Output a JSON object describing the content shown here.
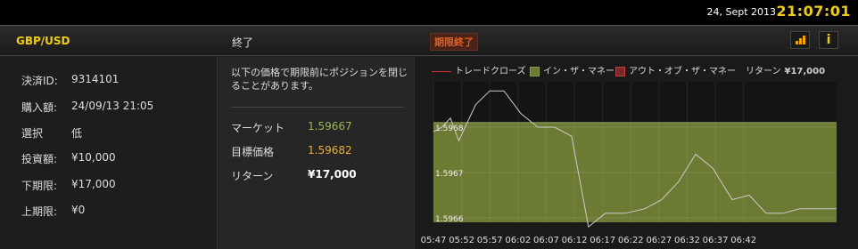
{
  "topbar": {
    "date": "24, Sept 2013",
    "clock": "21:07:01"
  },
  "header": {
    "pair": "GBP/USD",
    "status": "終了",
    "badge": "期限終了"
  },
  "details": [
    {
      "label": "決済ID:",
      "value": "9314101"
    },
    {
      "label": "購入額:",
      "value": "24/09/13 21:05"
    },
    {
      "label": "選択",
      "value": "低"
    },
    {
      "label": "投資額:",
      "value": "¥10,000"
    },
    {
      "label": "下期限:",
      "value": "¥17,000"
    },
    {
      "label": "上期限:",
      "value": "¥0"
    }
  ],
  "summary": {
    "note": "以下の価格で期限前にポジションを閉じることがあります。",
    "rows": [
      {
        "label": "マーケット",
        "value": "1.59667"
      },
      {
        "label": "目標価格",
        "value": "1.59682"
      },
      {
        "label": "リターン",
        "value": "¥17,000"
      }
    ]
  },
  "legend": {
    "close": "トレードクローズ",
    "in_money": "イン・ザ・マネー",
    "out_money": "アウト・オブ・ザ・マネー",
    "return_label": "リターン",
    "return_value": "¥17,000"
  },
  "colors": {
    "accent": "#f0d000",
    "in_money": "#6b7b33",
    "out_money": "#7a2a2a",
    "market_value": "#9ab850",
    "target_value": "#e8b030",
    "line": "#cccccc"
  },
  "icons": {
    "chart": "bar-chart-icon",
    "info": "info-icon"
  },
  "chart_data": {
    "type": "line",
    "x": [
      "05:47",
      "05:52",
      "05:57",
      "06:02",
      "06:07",
      "06:12",
      "06:17",
      "06:22",
      "06:27",
      "06:32",
      "06:37",
      "06:42"
    ],
    "ytick_labels": [
      "1.5968",
      "1.5967",
      "1.5966"
    ],
    "yticks": [
      1.5968,
      1.5967,
      1.5966
    ],
    "ylim": [
      1.59659,
      1.5969
    ],
    "in_money_range": [
      1.59659,
      1.59681
    ],
    "series": [
      {
        "values": [
          [
            0,
            1.59679
          ],
          [
            0.3,
            1.5968
          ],
          [
            0.6,
            1.59682
          ],
          [
            0.9,
            1.59677
          ],
          [
            1.5,
            1.59685
          ],
          [
            2.0,
            1.59688
          ],
          [
            2.5,
            1.59688
          ],
          [
            3.1,
            1.59683
          ],
          [
            3.7,
            1.5968
          ],
          [
            4.3,
            1.5968
          ],
          [
            4.9,
            1.59678
          ],
          [
            5.5,
            1.59658
          ],
          [
            6.1,
            1.59661
          ],
          [
            6.8,
            1.59661
          ],
          [
            7.5,
            1.59662
          ],
          [
            8.1,
            1.59664
          ],
          [
            8.7,
            1.59668
          ],
          [
            9.3,
            1.59674
          ],
          [
            9.9,
            1.59671
          ],
          [
            10.6,
            1.59664
          ],
          [
            11.2,
            1.59665
          ],
          [
            11.8,
            1.59661
          ],
          [
            12.4,
            1.59661
          ],
          [
            13.0,
            1.59662
          ],
          [
            13.6,
            1.59662
          ],
          [
            14.3,
            1.59662
          ]
        ]
      }
    ],
    "x_index_range": [
      0,
      14.3
    ],
    "grid": true
  }
}
